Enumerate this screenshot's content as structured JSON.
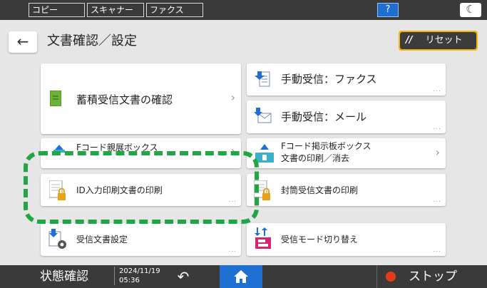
{
  "topbar": {
    "tabs": [
      "コピー",
      "スキャナー",
      "ファクス"
    ],
    "help_label": "?",
    "theme_label": "☾"
  },
  "header": {
    "title": "文書確認／設定",
    "back_label": "←",
    "reset_label": "リセット"
  },
  "cards": {
    "stored_received": "蓄積受信文書の確認",
    "manual_fax": "手動受信：ファクス",
    "manual_mail": "手動受信：メール",
    "fcode_parent_box": "Fコード親展ボックス",
    "fcode_bulletin_line1": "Fコード掲示板ボックス",
    "fcode_bulletin_line2": "文書の印刷／消去",
    "id_print": "ID入力印刷文書の印刷",
    "sealed_print": "封筒受信文書の印刷",
    "receive_settings": "受信文書設定",
    "receive_mode_switch": "受信モード切り替え",
    "more_dots": "..."
  },
  "bottombar": {
    "status_label": "状態確認",
    "date": "2024/11/19",
    "time": "05:36",
    "stop_label": "ストップ"
  },
  "colors": {
    "highlight": "#22a544",
    "accent_blue": "#1e6fd1",
    "reset_border": "#f5b400"
  }
}
